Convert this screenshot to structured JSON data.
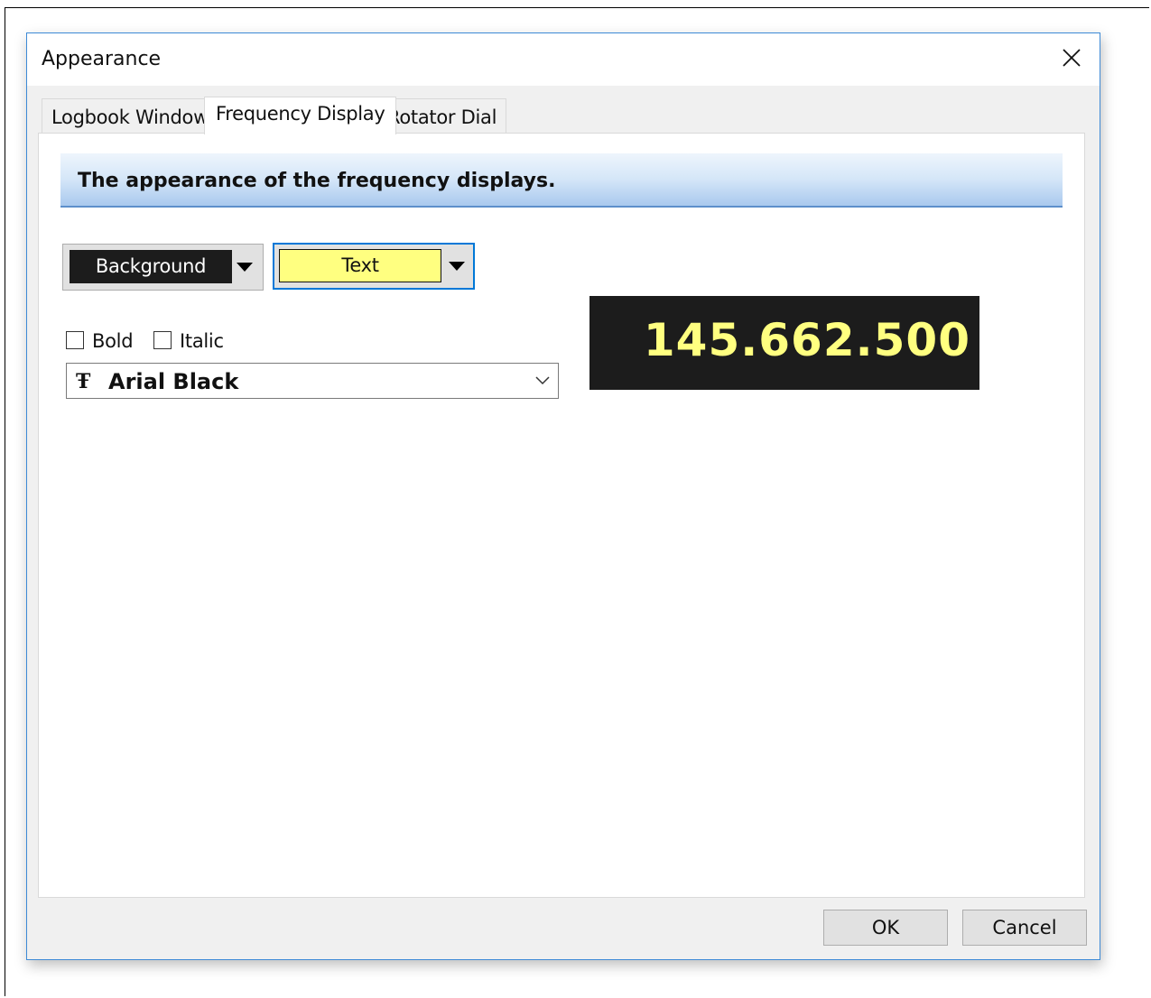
{
  "window": {
    "title": "Appearance"
  },
  "tabs": [
    {
      "label": "Logbook Window",
      "active": false
    },
    {
      "label": "Frequency Display",
      "active": true
    },
    {
      "label": "Rotator Dial",
      "active": false
    }
  ],
  "page": {
    "header_text": "The appearance of the frequency displays.",
    "background_combo": {
      "label": "Background",
      "color": "#1c1c1c",
      "text_color": "#ffffff"
    },
    "text_combo": {
      "label": "Text",
      "color": "#ffff80"
    },
    "bold": {
      "label": "Bold",
      "checked": false
    },
    "italic": {
      "label": "Italic",
      "checked": false
    },
    "font": {
      "selected": "Arial Black",
      "icon": "truetype-font-icon"
    },
    "preview": {
      "frequency": "145.662.500",
      "background": "#1c1c1c",
      "color": "#ffff80"
    }
  },
  "buttons": {
    "ok": "OK",
    "cancel": "Cancel"
  },
  "colors": {
    "accent": "#0078d7",
    "dialog_border": "#3d8ad6",
    "banner_line": "#5d8fcb"
  }
}
